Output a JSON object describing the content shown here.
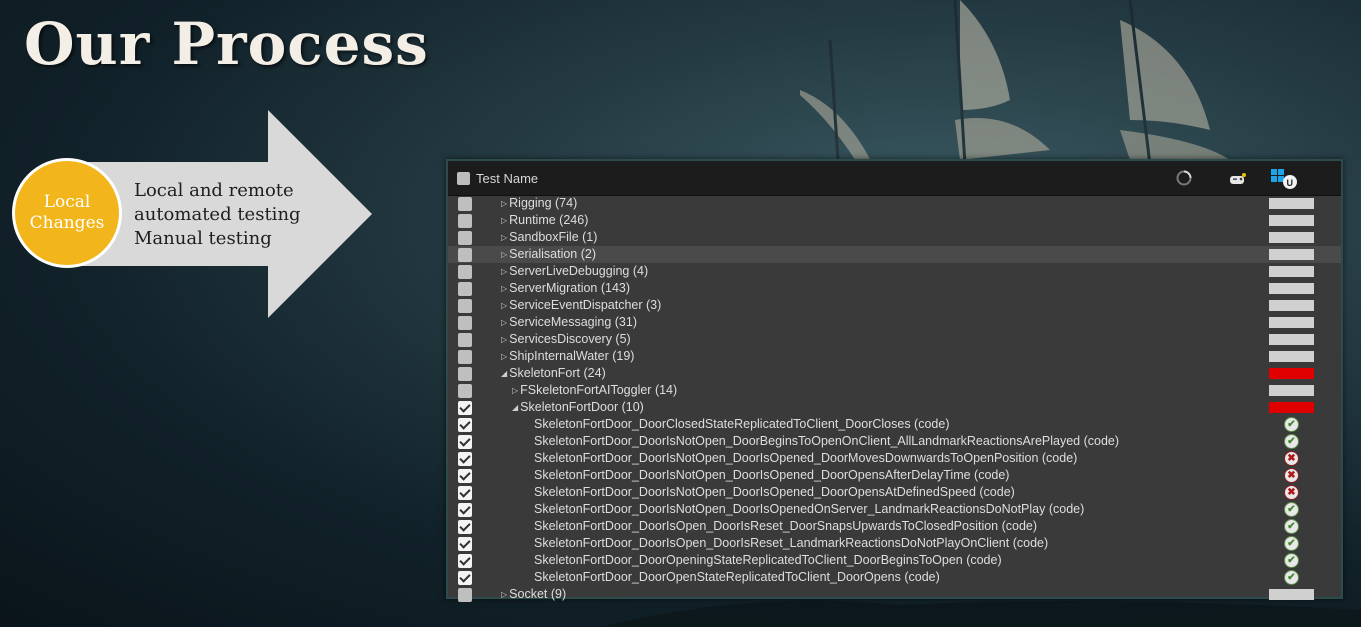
{
  "slide": {
    "title": "Our Process",
    "circle_line1": "Local",
    "circle_line2": "Changes",
    "arrow_lines": [
      "Local and remote",
      "automated testing",
      "Manual testing"
    ]
  },
  "panel": {
    "header_label": "Test Name",
    "header_icons": [
      "loading-spinner-icon",
      "gamepad-icon",
      "windows-unreal-icon"
    ],
    "rows": [
      {
        "label": "Rigging (74)",
        "level": 1,
        "toggle": "collapsed",
        "checked": false,
        "status": "bar-grey"
      },
      {
        "label": "Runtime (246)",
        "level": 1,
        "toggle": "collapsed",
        "checked": false,
        "status": "bar-grey"
      },
      {
        "label": "SandboxFile (1)",
        "level": 1,
        "toggle": "collapsed",
        "checked": false,
        "status": "bar-grey"
      },
      {
        "label": "Serialisation (2)",
        "level": 1,
        "toggle": "collapsed",
        "checked": false,
        "status": "bar-grey",
        "highlighted": true
      },
      {
        "label": "ServerLiveDebugging (4)",
        "level": 1,
        "toggle": "collapsed",
        "checked": false,
        "status": "bar-grey"
      },
      {
        "label": "ServerMigration (143)",
        "level": 1,
        "toggle": "collapsed",
        "checked": false,
        "status": "bar-grey"
      },
      {
        "label": "ServiceEventDispatcher (3)",
        "level": 1,
        "toggle": "collapsed",
        "checked": false,
        "status": "bar-grey"
      },
      {
        "label": "ServiceMessaging (31)",
        "level": 1,
        "toggle": "collapsed",
        "checked": false,
        "status": "bar-grey"
      },
      {
        "label": "ServicesDiscovery (5)",
        "level": 1,
        "toggle": "collapsed",
        "checked": false,
        "status": "bar-grey"
      },
      {
        "label": "ShipInternalWater (19)",
        "level": 1,
        "toggle": "collapsed",
        "checked": false,
        "status": "bar-grey"
      },
      {
        "label": "SkeletonFort (24)",
        "level": 1,
        "toggle": "expanded",
        "checked": false,
        "status": "bar-red"
      },
      {
        "label": "FSkeletonFortAIToggler (14)",
        "level": 2,
        "toggle": "collapsed",
        "checked": false,
        "status": "bar-grey"
      },
      {
        "label": "SkeletonFortDoor (10)",
        "level": 2,
        "toggle": "expanded",
        "checked": true,
        "status": "bar-red"
      },
      {
        "label": "SkeletonFortDoor_DoorClosedStateReplicatedToClient_DoorCloses (code)",
        "level": 3,
        "toggle": "",
        "checked": true,
        "status": "pass"
      },
      {
        "label": "SkeletonFortDoor_DoorIsNotOpen_DoorBeginsToOpenOnClient_AllLandmarkReactionsArePlayed (code)",
        "level": 3,
        "toggle": "",
        "checked": true,
        "status": "pass"
      },
      {
        "label": "SkeletonFortDoor_DoorIsNotOpen_DoorIsOpened_DoorMovesDownwardsToOpenPosition (code)",
        "level": 3,
        "toggle": "",
        "checked": true,
        "status": "fail"
      },
      {
        "label": "SkeletonFortDoor_DoorIsNotOpen_DoorIsOpened_DoorOpensAfterDelayTime (code)",
        "level": 3,
        "toggle": "",
        "checked": true,
        "status": "fail"
      },
      {
        "label": "SkeletonFortDoor_DoorIsNotOpen_DoorIsOpened_DoorOpensAtDefinedSpeed (code)",
        "level": 3,
        "toggle": "",
        "checked": true,
        "status": "fail"
      },
      {
        "label": "SkeletonFortDoor_DoorIsNotOpen_DoorIsOpenedOnServer_LandmarkReactionsDoNotPlay (code)",
        "level": 3,
        "toggle": "",
        "checked": true,
        "status": "pass"
      },
      {
        "label": "SkeletonFortDoor_DoorIsOpen_DoorIsReset_DoorSnapsUpwardsToClosedPosition (code)",
        "level": 3,
        "toggle": "",
        "checked": true,
        "status": "pass"
      },
      {
        "label": "SkeletonFortDoor_DoorIsOpen_DoorIsReset_LandmarkReactionsDoNotPlayOnClient (code)",
        "level": 3,
        "toggle": "",
        "checked": true,
        "status": "pass"
      },
      {
        "label": "SkeletonFortDoor_DoorOpeningStateReplicatedToClient_DoorBeginsToOpen (code)",
        "level": 3,
        "toggle": "",
        "checked": true,
        "status": "pass"
      },
      {
        "label": "SkeletonFortDoor_DoorOpenStateReplicatedToClient_DoorOpens (code)",
        "level": 3,
        "toggle": "",
        "checked": true,
        "status": "pass"
      },
      {
        "label": "Socket (9)",
        "level": 1,
        "toggle": "collapsed",
        "checked": false,
        "status": "bar-grey"
      }
    ]
  },
  "colors": {
    "accent_circle": "#f2b61c",
    "bar_grey": "#d0d0d0",
    "bar_red": "#e00000",
    "pass": "#3e8a2a",
    "fail": "#b01818"
  }
}
